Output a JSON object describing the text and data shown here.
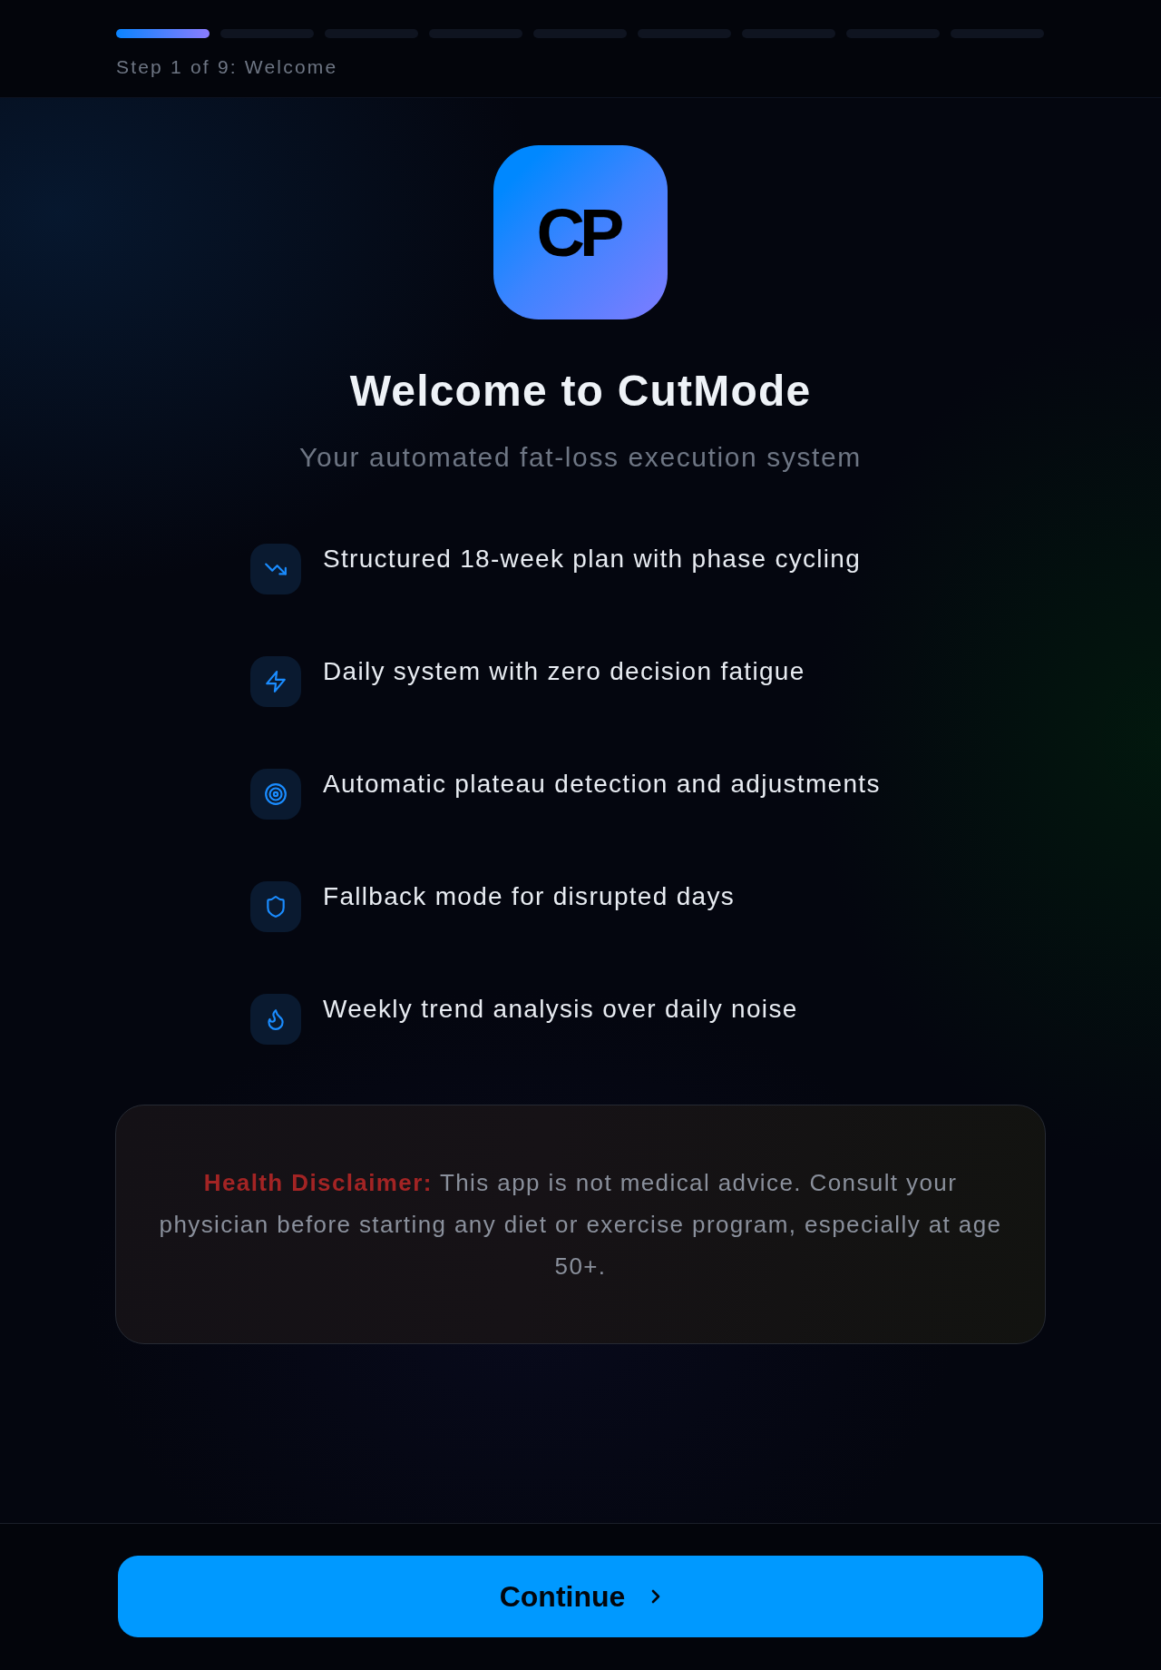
{
  "header": {
    "steps": [
      {
        "active": true
      },
      {
        "active": false
      },
      {
        "active": false
      },
      {
        "active": false
      },
      {
        "active": false
      },
      {
        "active": false
      },
      {
        "active": false
      },
      {
        "active": false
      },
      {
        "active": false
      }
    ],
    "label": "Step 1 of 9: Welcome"
  },
  "logo": {
    "text": "CP"
  },
  "title": "Welcome to CutMode",
  "subtitle": "Your automated fat-loss execution system",
  "features": [
    "Structured 18-week plan with phase cycling",
    "Daily system with zero decision fatigue",
    "Automatic plateau detection and adjustments",
    "Fallback mode for disrupted days",
    "Weekly trend analysis over daily noise"
  ],
  "disclaimer": {
    "text": "**Health Disclaimer:** This app is not medical advice. Consult your physician before starting any diet or exercise program, especially at age 50+."
  },
  "footer": {
    "button": {
      "label": "Continue"
    }
  }
}
